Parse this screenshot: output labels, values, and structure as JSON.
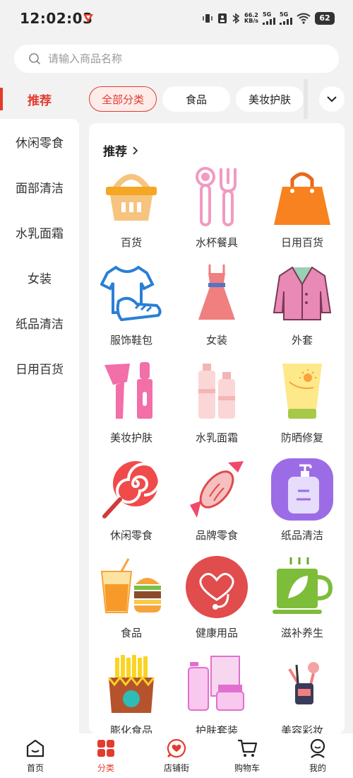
{
  "status": {
    "time": "12:02:03",
    "net_speed": "66.2",
    "net_unit": "KB/s",
    "sig1": "5G",
    "sig2": "5G",
    "battery": "62"
  },
  "search": {
    "placeholder": "请输入商品名称"
  },
  "sidebar": {
    "items": [
      {
        "label": "推荐"
      },
      {
        "label": "休闲零食"
      },
      {
        "label": "面部清洁"
      },
      {
        "label": "水乳面霜"
      },
      {
        "label": "女装"
      },
      {
        "label": "纸品清洁"
      },
      {
        "label": "日用百货"
      }
    ]
  },
  "chips": [
    {
      "label": "全部分类"
    },
    {
      "label": "食品"
    },
    {
      "label": "美妆护肤"
    }
  ],
  "panel": {
    "title": "推荐",
    "categories": [
      {
        "label": "百货",
        "icon": "basket-icon"
      },
      {
        "label": "水杯餐具",
        "icon": "utensils-icon"
      },
      {
        "label": "日用百货",
        "icon": "handbag-icon"
      },
      {
        "label": "服饰鞋包",
        "icon": "tshirt-shoe-icon"
      },
      {
        "label": "女装",
        "icon": "dress-icon"
      },
      {
        "label": "外套",
        "icon": "jacket-icon"
      },
      {
        "label": "美妆护肤",
        "icon": "makeup-brush-icon"
      },
      {
        "label": "水乳面霜",
        "icon": "lotion-bottles-icon"
      },
      {
        "label": "防晒修复",
        "icon": "sunscreen-icon"
      },
      {
        "label": "休闲零食",
        "icon": "lollipop-icon"
      },
      {
        "label": "品牌零食",
        "icon": "candy-icon"
      },
      {
        "label": "纸品清洁",
        "icon": "soap-dispenser-icon"
      },
      {
        "label": "食品",
        "icon": "burger-drink-icon"
      },
      {
        "label": "健康用品",
        "icon": "stethoscope-heart-icon"
      },
      {
        "label": "滋补养生",
        "icon": "tea-cup-icon"
      },
      {
        "label": "膨化食品",
        "icon": "fries-icon"
      },
      {
        "label": "护肤套装",
        "icon": "skincare-set-icon"
      },
      {
        "label": "美容彩妆",
        "icon": "cosmetics-icon"
      }
    ]
  },
  "nav": [
    {
      "label": "首页",
      "icon": "home-icon"
    },
    {
      "label": "分类",
      "icon": "category-icon"
    },
    {
      "label": "店铺街",
      "icon": "shop-heart-icon"
    },
    {
      "label": "购物车",
      "icon": "cart-icon"
    },
    {
      "label": "我的",
      "icon": "profile-icon"
    }
  ],
  "colors": {
    "accent": "#e33b2e",
    "background": "#f2f2f2"
  }
}
